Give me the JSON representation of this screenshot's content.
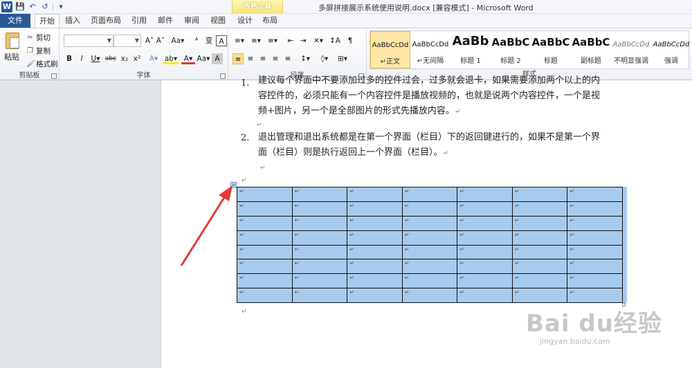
{
  "window": {
    "title": "多屏拼接展示系统使用说明.docx [兼容模式] - Microsoft Word",
    "app_icon": "W",
    "context_tab_group": "表格工具"
  },
  "quick_access": {
    "save_icon": "💾",
    "undo_icon": "↶",
    "redo_icon": "↺",
    "customize_icon": "▾"
  },
  "tabs": [
    {
      "label": "文件"
    },
    {
      "label": "开始"
    },
    {
      "label": "插入"
    },
    {
      "label": "页面布局"
    },
    {
      "label": "引用"
    },
    {
      "label": "邮件"
    },
    {
      "label": "审阅"
    },
    {
      "label": "视图"
    },
    {
      "label": "设计"
    },
    {
      "label": "布局"
    }
  ],
  "ribbon": {
    "clipboard": {
      "label": "剪贴板",
      "paste": "粘贴",
      "cut": "剪切",
      "copy": "复制",
      "format_painter": "格式刷"
    },
    "font": {
      "label": "字体",
      "buttons": [
        "A˄",
        "A˅",
        "Aa▾",
        "ᴬ",
        "变",
        "A"
      ],
      "row2": [
        "B",
        "I",
        "U▾",
        "abc",
        "x₂",
        "x²",
        "A▾",
        "ab▾",
        "A▾",
        "Aa▾",
        "A",
        "A"
      ]
    },
    "paragraph": {
      "label": "段落",
      "row1": [
        "≡▾",
        "≡▾",
        "≡▾",
        "⇤",
        "⇥",
        "✕▾",
        "↕A",
        "¶"
      ],
      "row2": [
        "≡",
        "≡",
        "≡",
        "≡",
        "≡",
        "↕▾",
        "◊▾",
        "⊞▾"
      ]
    },
    "styles": {
      "label": "样式",
      "items": [
        {
          "sample": "AaBbCcDd",
          "name": "↵正文"
        },
        {
          "sample": "AaBbCcDd",
          "name": "↵无间隔"
        },
        {
          "sample": "AaBb",
          "name": "标题 1"
        },
        {
          "sample": "AaBbC",
          "name": "标题 2"
        },
        {
          "sample": "AaBbC",
          "name": "标题"
        },
        {
          "sample": "AaBbC",
          "name": "副标题"
        },
        {
          "sample": "AaBbCcDd",
          "name": "不明显强调"
        },
        {
          "sample": "AaBbCcDd",
          "name": "强调"
        }
      ]
    }
  },
  "document": {
    "item1_num": "1.",
    "item1_line1": "建议每个界面中不要添加过多的控件过会，过多就会退卡，如果需要添加两个以上的内",
    "item1_line2": "容控件的，必须只能有一个内容控件是播放视频的，也就是说两个内容控件，一个是视",
    "item1_line3": "频+图片，另一个是全部图片的形式先播放内容。",
    "item2_num": "2.",
    "item2_line1": "退出管理和退出系统都是在第一个界面（栏目）下的返回键进行的，如果不是第一个界",
    "item2_line2": "面（栏目）则是执行返回上一个界面（栏目）。",
    "para_mark": "↵",
    "table_handle": "⊞",
    "table": {
      "rows": 8,
      "cols": 7
    }
  },
  "watermark": {
    "logo": "Bai du经验",
    "url": "jingyan.baidu.com"
  },
  "colors": {
    "accent": "#2b5797",
    "table_selection": "#a7cbef",
    "arrow": "#e53935"
  }
}
